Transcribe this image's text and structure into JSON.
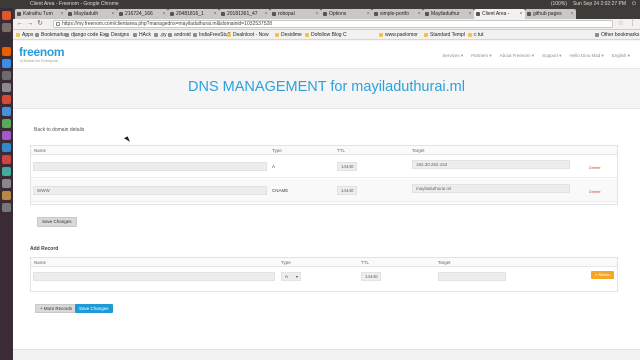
{
  "system_bar": {
    "window_title": "Client Area - Freenom - Google Chrome",
    "indicators": [
      "(100%)",
      "Sun Sep 24 2:02:27 PM"
    ]
  },
  "launcher": {
    "icons": [
      "ubuntu-dash-icon",
      "files-icon",
      "terminal-icon",
      "firefox-icon",
      "chrome-icon",
      "editor-icon",
      "settings-icon",
      "software-icon",
      "app-icon",
      "app-icon",
      "app-icon",
      "app-icon",
      "app-icon",
      "app-icon",
      "app-icon",
      "app-icon",
      "trash-icon"
    ],
    "colors": [
      "#e0582a",
      "#7a6f66",
      "#2f2f2f",
      "#e66000",
      "#3a8ee6",
      "#6c6c6c",
      "#8a8a8a",
      "#d24b35",
      "#4a90d9",
      "#5aa85a",
      "#a25acb",
      "#3388cc",
      "#cc4444",
      "#44aa99",
      "#888888",
      "#bb8844",
      "#777777"
    ]
  },
  "tabs": [
    {
      "label": "Kalrathu Tum",
      "active": false
    },
    {
      "label": "Mayiladuth",
      "active": false
    },
    {
      "label": "216724_166",
      "active": false
    },
    {
      "label": "20481816_1",
      "active": false
    },
    {
      "label": "20181361_47",
      "active": false
    },
    {
      "label": "robopal",
      "active": false
    },
    {
      "label": "Options",
      "active": false
    },
    {
      "label": "simple-portfo",
      "active": false
    },
    {
      "label": "Mayiladuthur",
      "active": false
    },
    {
      "label": "Client Area -",
      "active": true
    },
    {
      "label": "github pages",
      "active": false
    }
  ],
  "url": {
    "protocol_label": "Secure",
    "address": "https://my.freenom.com/clientarea.php?managedns=mayiladuthurai.ml&domainid=1032537528"
  },
  "bookmarks": [
    {
      "label": "Apps",
      "folder": false
    },
    {
      "label": "Bookmarks",
      "folder": true
    },
    {
      "label": "django code Ex",
      "folder": true
    },
    {
      "label": "Designs",
      "folder": true
    },
    {
      "label": "HAck",
      "folder": true
    },
    {
      "label": ".py",
      "folder": true
    },
    {
      "label": "android",
      "folder": true
    },
    {
      "label": "IndiaFreeStuff",
      "folder": true
    },
    {
      "label": "Dealnloot - Now",
      "folder": false
    },
    {
      "label": "Desidime",
      "folder": false
    },
    {
      "label": "Dofollow Blog C",
      "folder": false
    },
    {
      "label": "www.paolomor",
      "folder": false
    },
    {
      "label": "Standard Templ",
      "folder": false
    },
    {
      "label": "c tut",
      "folder": false
    },
    {
      "label": "Other bookmarks",
      "folder": true
    }
  ],
  "site": {
    "logo": "freenom",
    "tagline": "A Name for Everyone",
    "nav": [
      "Services ▾",
      "Partners ▾",
      "About Freenom ▾",
      "Support ▾",
      "Hello Dinu Mad ▾",
      "English ▾"
    ]
  },
  "hero": {
    "title": "DNS MANAGEMENT for mayiladuthurai.ml"
  },
  "back_link": "Back to domain details",
  "records": {
    "headers": {
      "name": "Name",
      "type": "Type",
      "ttl": "TTL",
      "target": "Target"
    },
    "rows": [
      {
        "name": "",
        "type": "A",
        "ttl": "14440",
        "target": "192.30.252.153",
        "delete": "Delete"
      },
      {
        "name": "WWW",
        "type": "CNAME",
        "ttl": "14440",
        "target": "mayiladuthurai.ml",
        "delete": "Delete"
      }
    ],
    "save_label": "Save Changes"
  },
  "add_record": {
    "heading": "Add Record",
    "headers": {
      "name": "Name",
      "type": "Type",
      "ttl": "TTL",
      "target": "Target"
    },
    "row": {
      "name": "",
      "type": "A",
      "ttl": "14440",
      "target": ""
    },
    "return_label": "× Return"
  },
  "bottom_buttons": {
    "more": "+ More Records",
    "save": "Save Changes"
  }
}
